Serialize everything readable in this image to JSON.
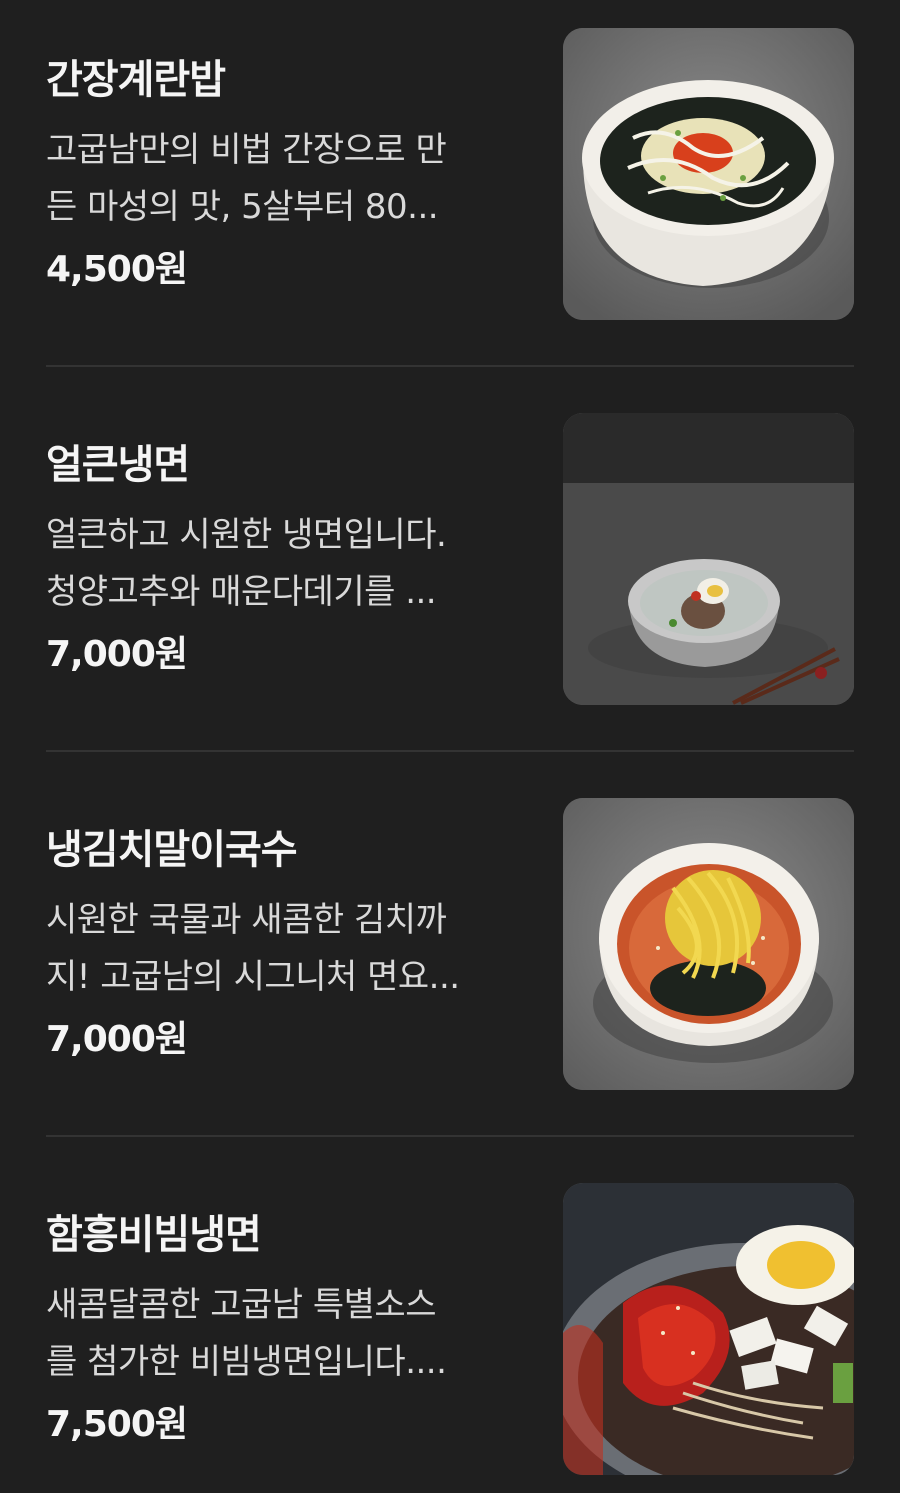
{
  "menu": {
    "items": [
      {
        "name": "간장계란밥",
        "description_lines": [
          "고굽남만의 비법 간장으로 만",
          "든 마성의 맛, 5살부터 80..."
        ],
        "price": "4,500원",
        "photo_icon": "egg-rice-bowl-photo"
      },
      {
        "name": "얼큰냉면",
        "description_lines": [
          "얼큰하고 시원한 냉면입니다.",
          "청양고추와 매운다데기를 ..."
        ],
        "price": "7,000원",
        "photo_icon": "spicy-naengmyeon-photo"
      },
      {
        "name": "냉김치말이국수",
        "description_lines": [
          "시원한 국물과 새콤한 김치까",
          "지! 고굽남의 시그니처 면요..."
        ],
        "price": "7,000원",
        "photo_icon": "kimchi-noodle-photo"
      },
      {
        "name": "함흥비빔냉면",
        "description_lines": [
          "새콤달콤한 고굽남 특별소스",
          "를 첨가한 비빔냉면입니다...."
        ],
        "price": "7,500원",
        "photo_icon": "bibim-naengmyeon-photo"
      }
    ]
  },
  "colors": {
    "background": "#1f1f1f",
    "text_primary": "#f5f5f5",
    "text_secondary": "#d9d9d9",
    "divider": "#333333"
  }
}
